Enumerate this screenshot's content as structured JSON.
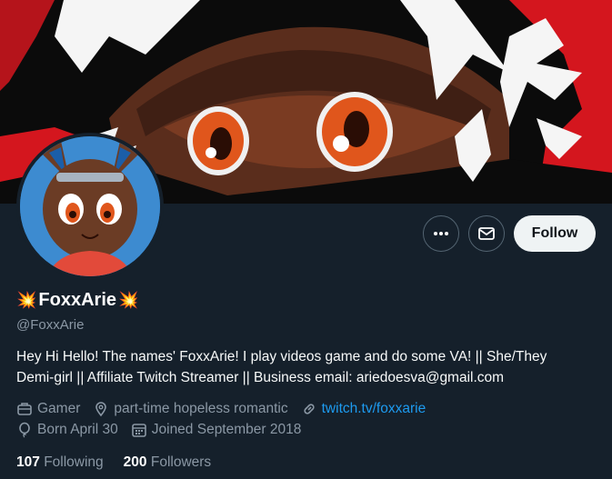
{
  "profile": {
    "name_emoji_left": "💥",
    "display_name": "FoxxArie",
    "name_emoji_right": "💥",
    "handle": "@FoxxArie",
    "bio_line1": "Hey Hi Hello! The names' FoxxArie! I play videos game and do some VA! || She/They",
    "bio_line2": "Demi-girl || Affiliate Twitch Streamer || Business email: ariedoesva@gmail.com",
    "category": "Gamer",
    "location": "part-time hopeless romantic",
    "website": "twitch.tv/foxxarie",
    "birthday": "Born April 30",
    "joined": "Joined September 2018"
  },
  "actions": {
    "follow_label": "Follow",
    "more_icon": "more-dots-icon",
    "message_icon": "envelope-icon"
  },
  "stats": {
    "following_count": "107",
    "following_label": "Following",
    "followers_count": "200",
    "followers_label": "Followers"
  },
  "colors": {
    "background": "#15202b",
    "accent_link": "#1d9bf0",
    "muted_text": "#8b98a5",
    "banner_red": "#d4161e"
  }
}
